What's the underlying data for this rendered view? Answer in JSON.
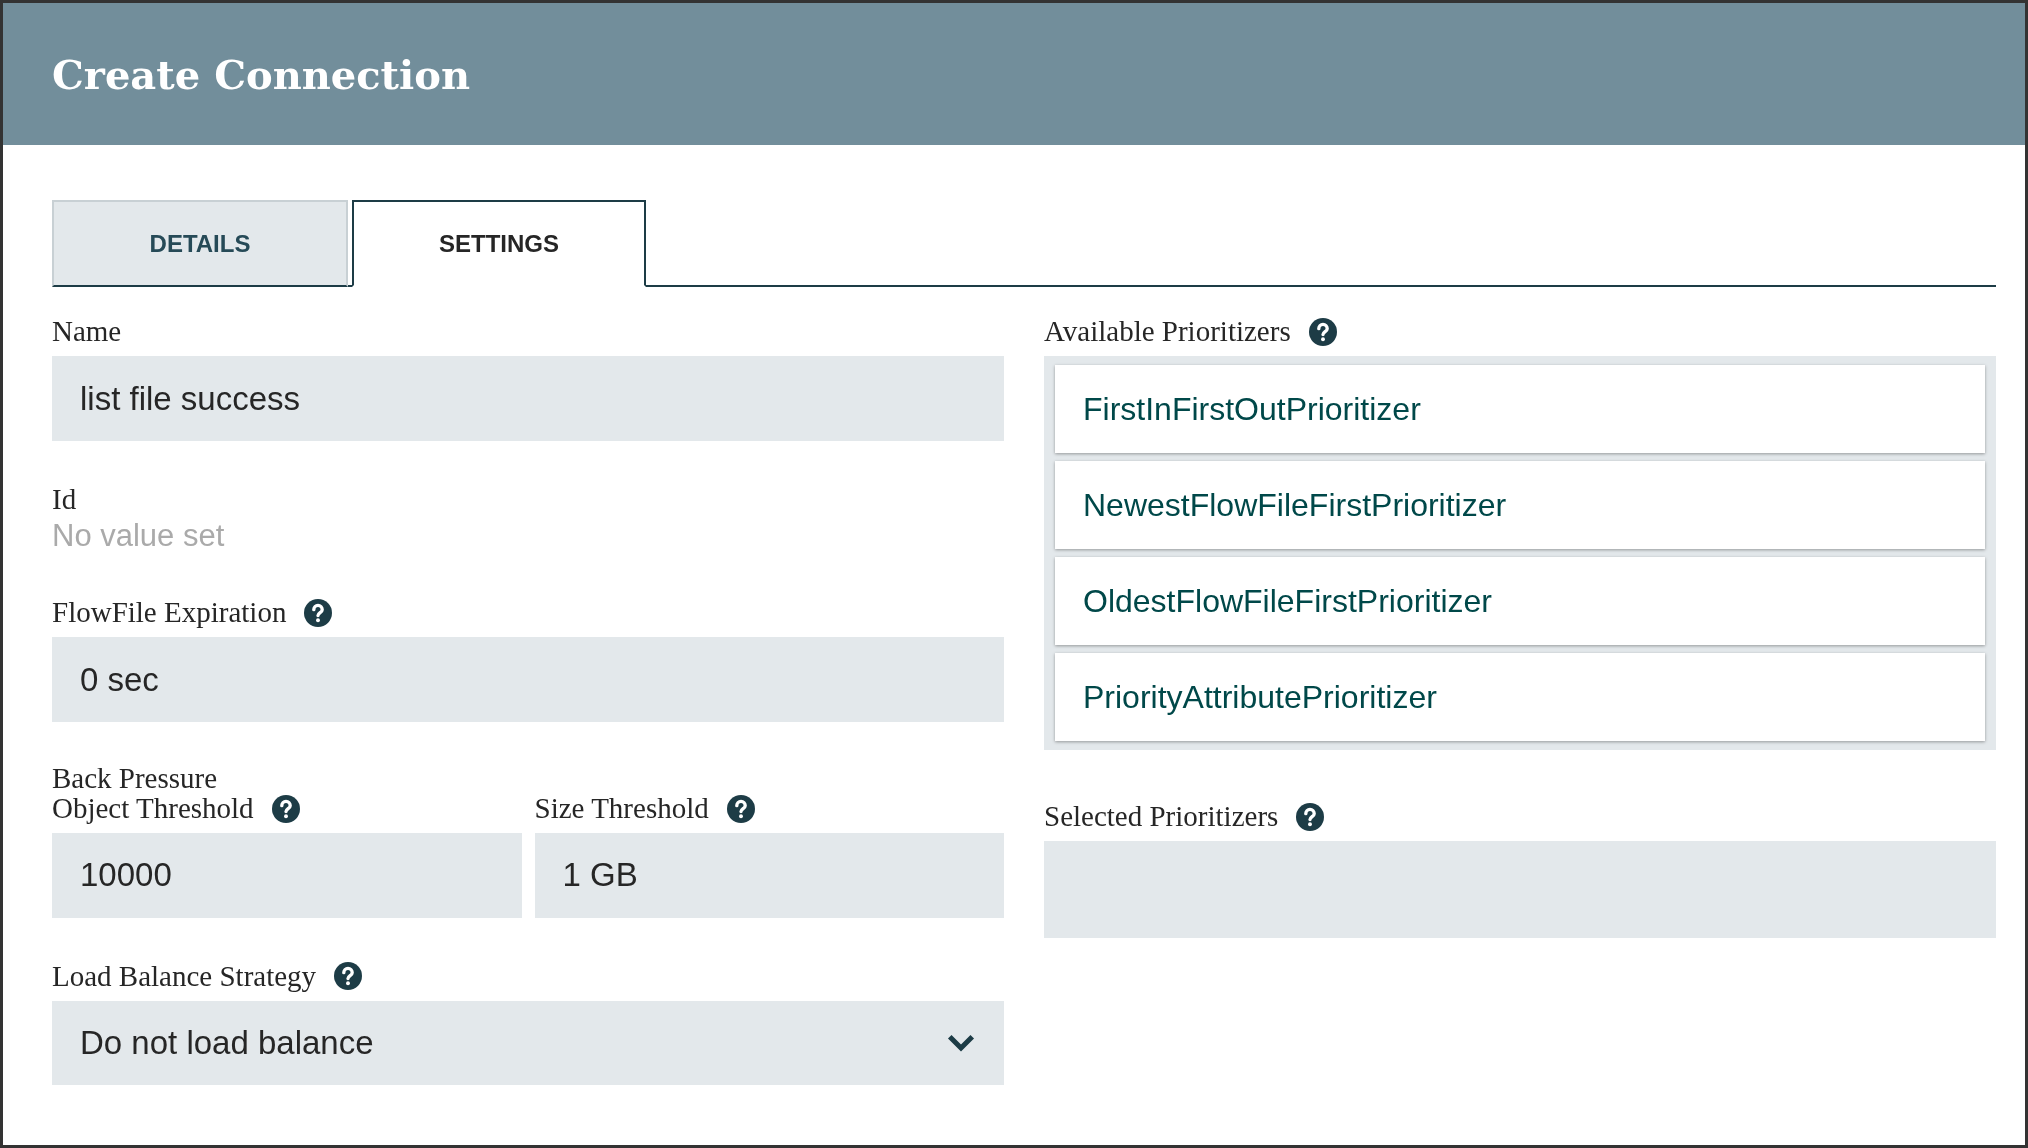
{
  "dialog": {
    "title": "Create Connection"
  },
  "tabs": [
    {
      "label": "DETAILS",
      "selected": false
    },
    {
      "label": "SETTINGS",
      "selected": true
    }
  ],
  "name": {
    "label": "Name",
    "value": "list file success"
  },
  "id": {
    "label": "Id",
    "value": "No value set"
  },
  "flowfile_expiration": {
    "label": "FlowFile Expiration",
    "value": "0 sec"
  },
  "back_pressure": {
    "label": "Back Pressure",
    "object_threshold": {
      "label": "Object Threshold",
      "value": "10000"
    },
    "size_threshold": {
      "label": "Size Threshold",
      "value": "1 GB"
    }
  },
  "load_balance_strategy": {
    "label": "Load Balance Strategy",
    "value": "Do not load balance"
  },
  "available_prioritizers": {
    "label": "Available Prioritizers",
    "items": [
      "FirstInFirstOutPrioritizer",
      "NewestFlowFileFirstPrioritizer",
      "OldestFlowFileFirstPrioritizer",
      "PriorityAttributePrioritizer"
    ]
  },
  "selected_prioritizers": {
    "label": "Selected Prioritizers"
  }
}
